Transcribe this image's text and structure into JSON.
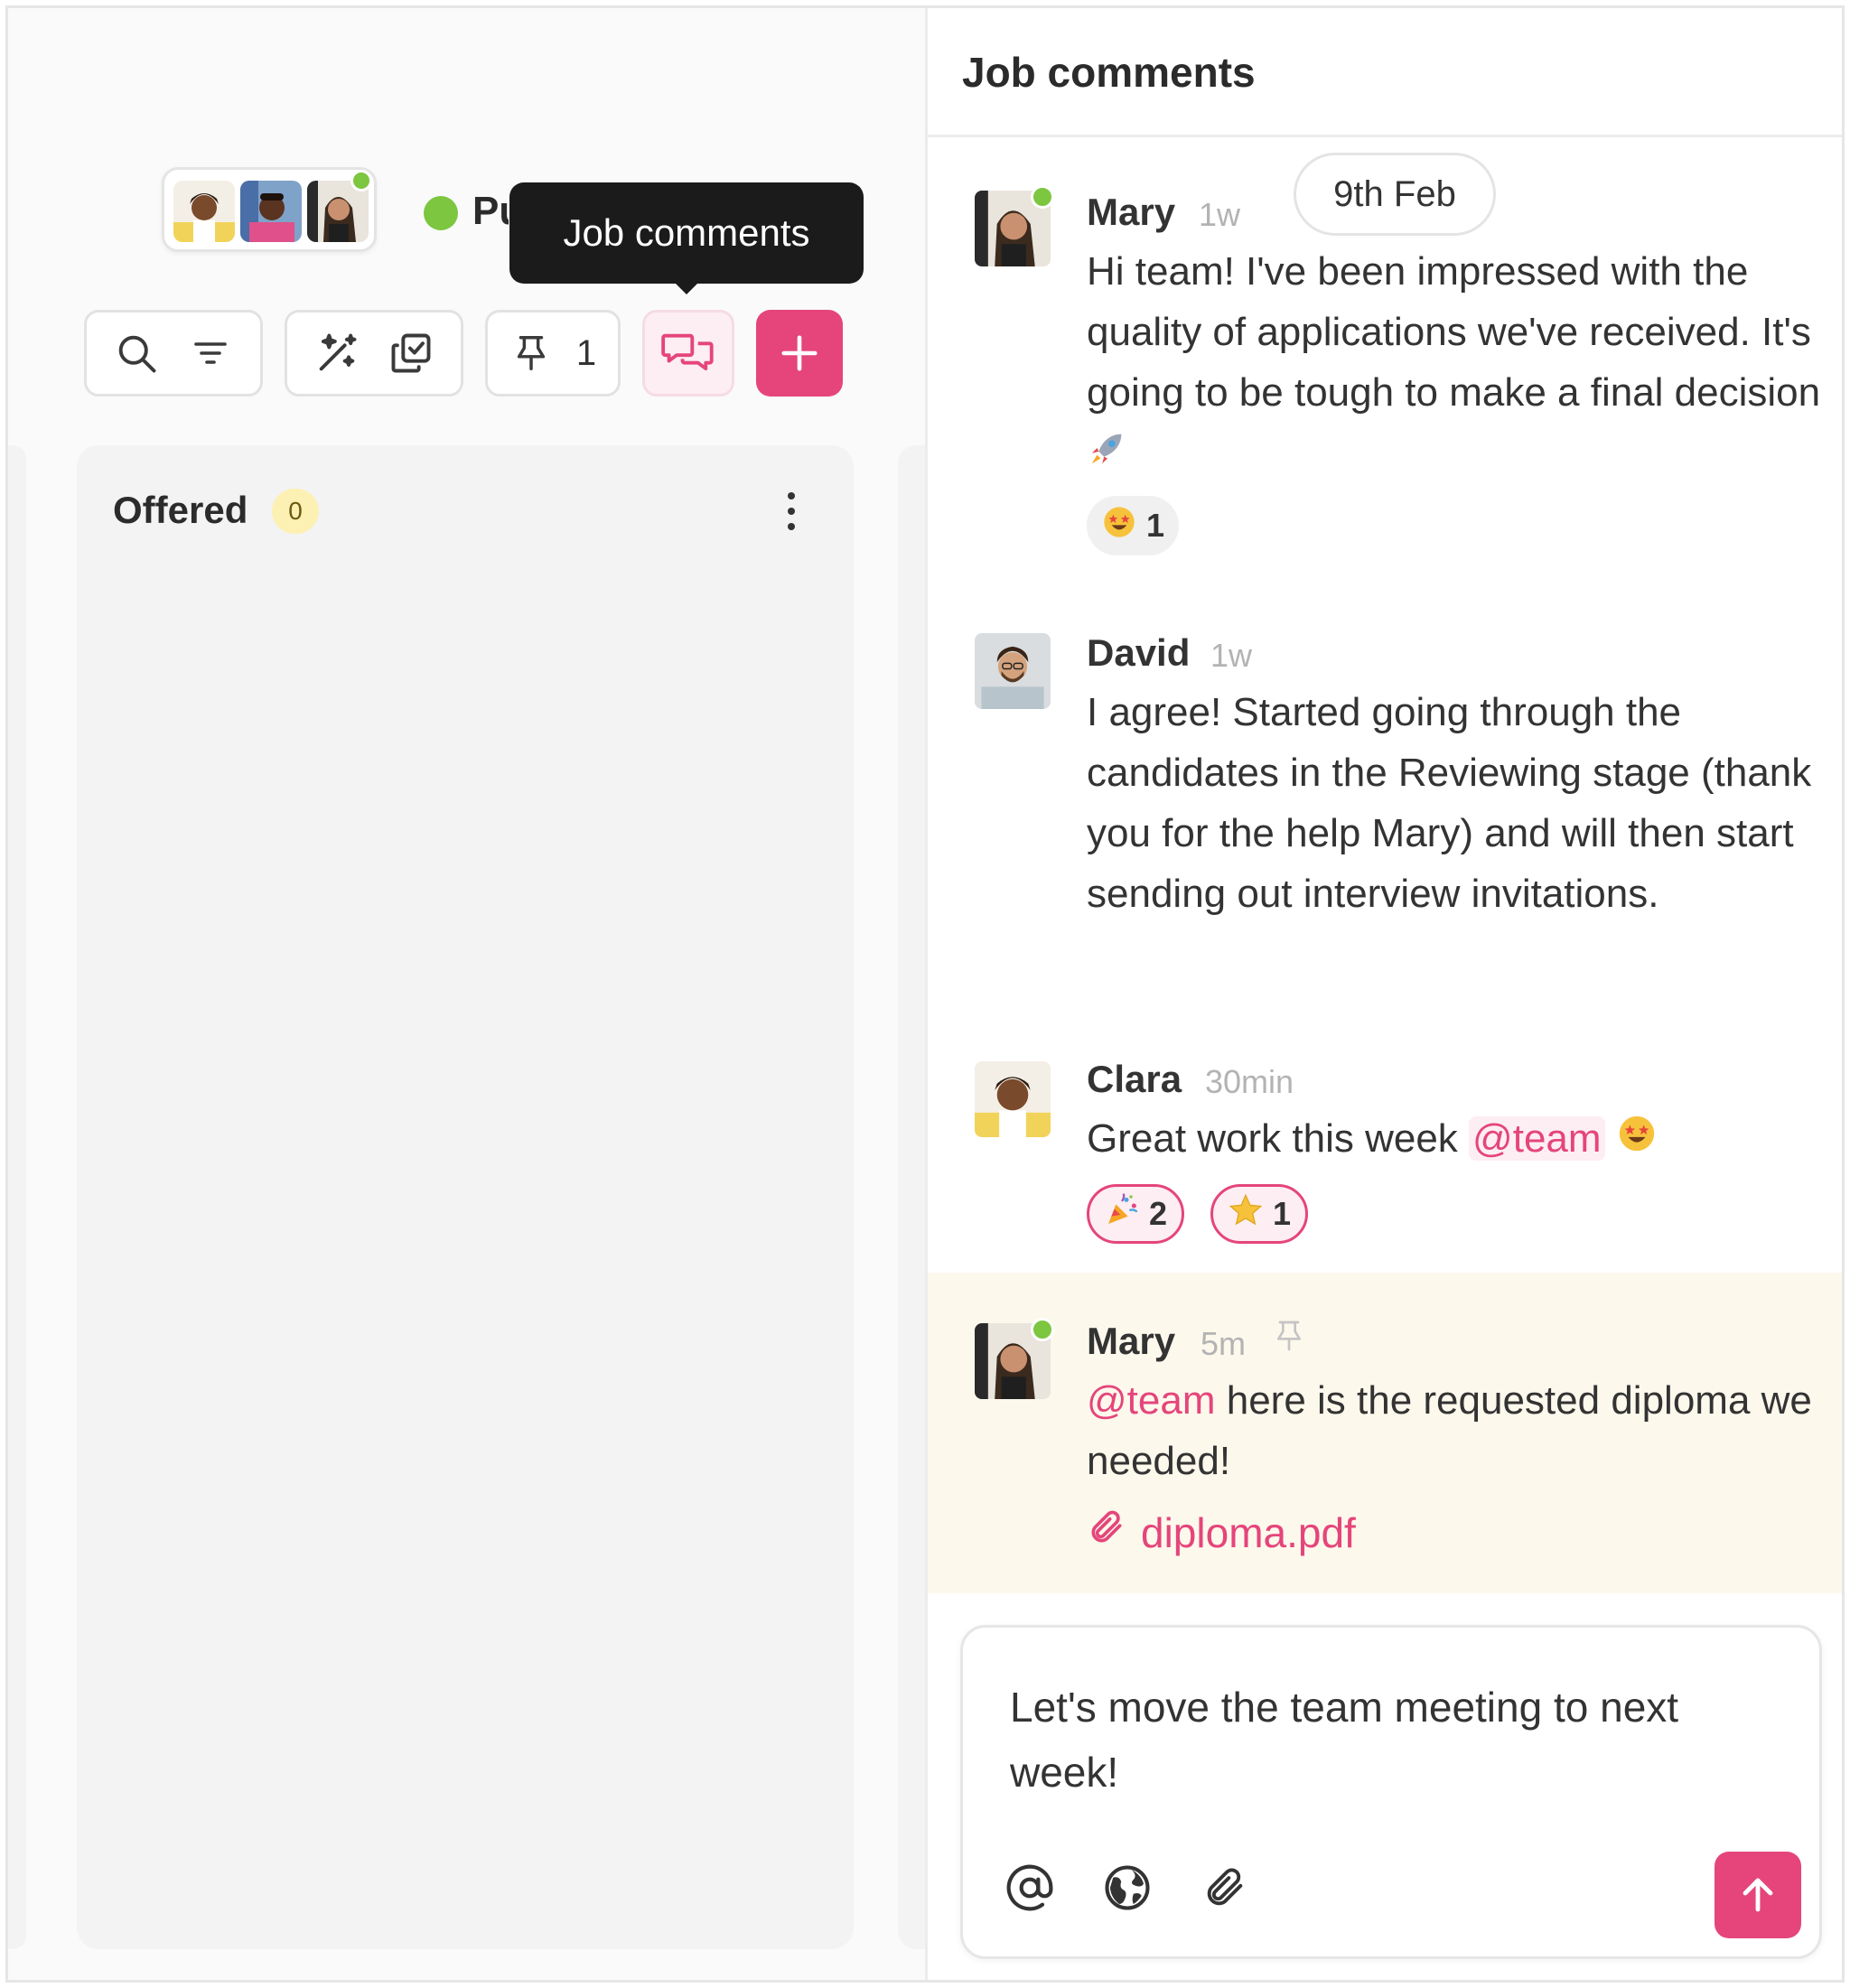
{
  "toolbar": {
    "tooltip_label": "Job comments",
    "status_text": "Pu",
    "pinned_count": "1"
  },
  "column": {
    "title": "Offered",
    "count": "0"
  },
  "panel": {
    "title": "Job comments",
    "date_chip": "9th Feb",
    "comments": [
      {
        "author": "Mary",
        "time": "1w",
        "text": "Hi team! I've been impressed with the quality of applications we've received. It's going to be tough to make a final decision",
        "reactions": [
          {
            "emoji": "star-struck",
            "count": "1"
          }
        ]
      },
      {
        "author": "David",
        "time": "1w",
        "text": "I agree! Started going through the candidates in the Reviewing stage (thank you for the help Mary) and will then start sending out interview invitations."
      },
      {
        "author": "Clara",
        "time": "30min",
        "text": "Great work this week",
        "mention": "@team",
        "reactions": [
          {
            "emoji": "party-popper",
            "count": "2"
          },
          {
            "emoji": "star",
            "count": "1"
          }
        ]
      },
      {
        "author": "Mary",
        "time": "5m",
        "mention": "@team",
        "text": "here is the requested diploma we needed!",
        "attachment": "diploma.pdf"
      }
    ]
  },
  "composer": {
    "text": "Let's move the team meeting to next week!"
  },
  "colors": {
    "accent": "#e5457b",
    "online": "#7cc640",
    "pinned_bg": "#fcf8ec"
  }
}
